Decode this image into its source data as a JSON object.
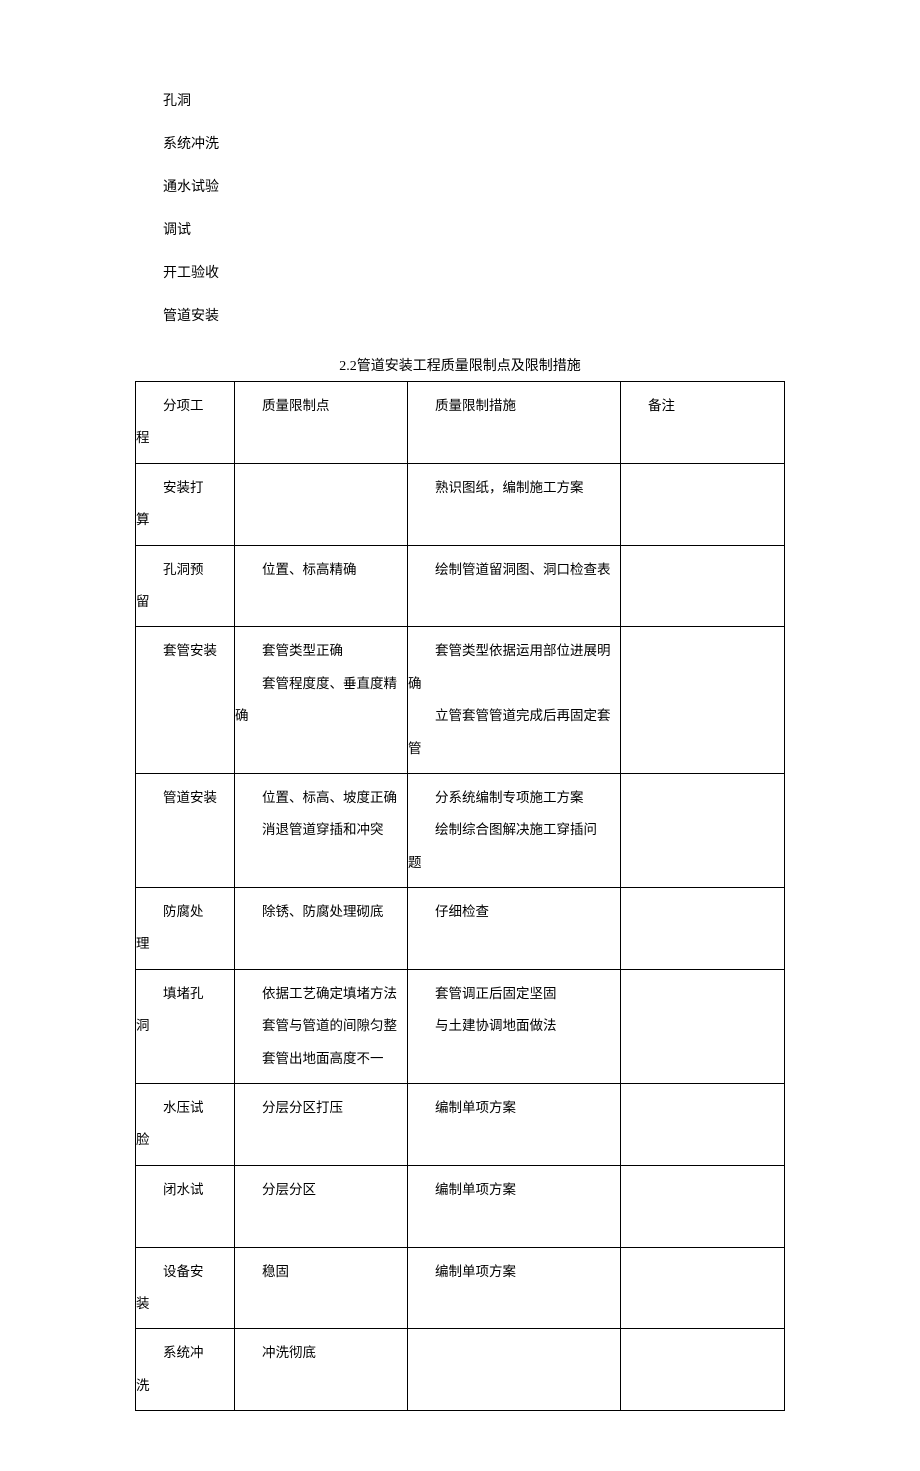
{
  "list_items": [
    "孔洞",
    "系统冲洗",
    "通水试验",
    "调试",
    "开工验收",
    "管道安装"
  ],
  "table_title": "2.2管道安装工程质量限制点及限制措施",
  "headers": {
    "c1": "分项工程",
    "c2": "质量限制点",
    "c3": "质量限制措施",
    "c4": "备注"
  },
  "rows": [
    {
      "c1": [
        "安装打",
        "算"
      ],
      "c2": [
        ""
      ],
      "c3": [
        "熟识图纸，编制施工方案"
      ],
      "c4": ""
    },
    {
      "c1": [
        "孔洞预",
        "留"
      ],
      "c2": [
        "位置、标高精确"
      ],
      "c3": [
        "绘制管道留洞图、洞口检查表"
      ],
      "c4": ""
    },
    {
      "c1": [
        "套管安装"
      ],
      "c2": [
        "套管类型正确",
        "套管程度度、垂直度精确"
      ],
      "c3": [
        "套管类型依据运用部位进展明",
        "确",
        "立管套管管道完成后再固定套",
        "管"
      ],
      "c4": ""
    },
    {
      "c1": [
        "管道安装"
      ],
      "c2": [
        "位置、标高、坡度正确",
        "消退管道穿插和冲突"
      ],
      "c3": [
        "分系统编制专项施工方案",
        "绘制综合图解决施工穿插问",
        "题"
      ],
      "c4": ""
    },
    {
      "c1": [
        "防腐处",
        "理"
      ],
      "c2": [
        "除锈、防腐处理砌底"
      ],
      "c3": [
        "仔细检查"
      ],
      "c4": ""
    },
    {
      "c1": [
        "填堵孔",
        "洞"
      ],
      "c2": [
        "依据工艺确定填堵方法",
        "套管与管道的间隙匀整",
        "套管出地面高度不一"
      ],
      "c3": [
        "套管调正后固定坚固",
        "与土建协调地面做法"
      ],
      "c4": ""
    },
    {
      "c1": [
        "水压试",
        "脸"
      ],
      "c2": [
        "分层分区打压"
      ],
      "c3": [
        "编制单项方案"
      ],
      "c4": ""
    },
    {
      "c1": [
        "闭水试"
      ],
      "c2": [
        "分层分区"
      ],
      "c3": [
        "编制单项方案"
      ],
      "c4": ""
    },
    {
      "c1": [
        "设备安",
        "装"
      ],
      "c2": [
        "稳固"
      ],
      "c3": [
        "编制单项方案"
      ],
      "c4": ""
    },
    {
      "c1": [
        "系统冲",
        "洗"
      ],
      "c2": [
        "冲洗彻底"
      ],
      "c3": [
        ""
      ],
      "c4": ""
    }
  ]
}
